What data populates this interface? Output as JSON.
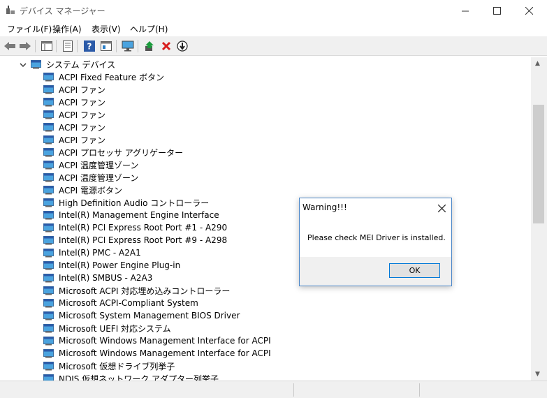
{
  "window": {
    "title": "デバイス マネージャー",
    "controls": {
      "minimize": "—",
      "maximize": "☐",
      "close": "✕"
    }
  },
  "menu": [
    "ファイル(F)",
    "操作(A)",
    "表示(V)",
    "ヘルプ(H)"
  ],
  "toolbar": {
    "icons": [
      "back-arrow-icon",
      "forward-arrow-icon",
      "properties-icon",
      "computer-list-icon",
      "help-icon",
      "view-icon",
      "monitor-icon",
      "update-driver-icon",
      "uninstall-icon",
      "disable-icon"
    ]
  },
  "tree": {
    "category": "システム デバイス",
    "items": [
      "ACPI Fixed Feature ボタン",
      "ACPI ファン",
      "ACPI ファン",
      "ACPI ファン",
      "ACPI ファン",
      "ACPI ファン",
      "ACPI プロセッサ アグリゲーター",
      "ACPI 温度管理ゾーン",
      "ACPI 温度管理ゾーン",
      "ACPI 電源ボタン",
      "High Definition Audio コントローラー",
      "Intel(R) Management Engine Interface",
      "Intel(R) PCI Express Root Port #1 - A290",
      "Intel(R) PCI Express Root Port #9 - A298",
      "Intel(R) PMC - A2A1",
      "Intel(R) Power Engine Plug-in",
      "Intel(R) SMBUS - A2A3",
      "Microsoft ACPI 対応埋め込みコントローラー",
      "Microsoft ACPI-Compliant System",
      "Microsoft System Management BIOS Driver",
      "Microsoft UEFI 対応システム",
      "Microsoft Windows Management Interface for ACPI",
      "Microsoft Windows Management Interface for ACPI",
      "Microsoft 仮想ドライブ列挙子",
      "NDIS 仮想ネットワーク アダプター列挙子"
    ]
  },
  "dialog": {
    "title": "Warning!!!",
    "message": "Please check MEI Driver is installed.",
    "ok_label": "OK"
  },
  "colors": {
    "accent": "#0078d7",
    "toolbar_bg": "#f0f0f0",
    "icon_blue": "#2a7ec6"
  }
}
